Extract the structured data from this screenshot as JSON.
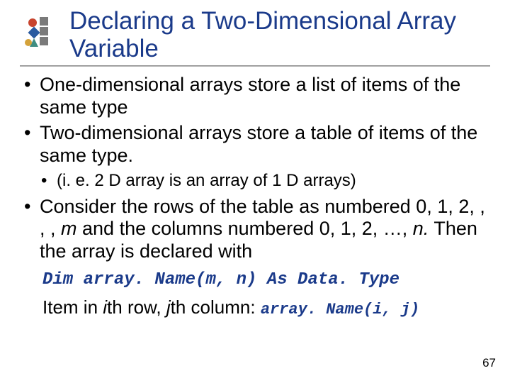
{
  "title": "Declaring a Two-Dimensional Array Variable",
  "bullets": {
    "b1": "One-dimensional arrays store a list of items of the same type",
    "b2": "Two-dimensional arrays store a table of items of the same type.",
    "b2a": "(i. e. 2 D array is an array of 1 D arrays)",
    "b3_pre": "Consider the rows of the table as numbered 0, 1, 2, , , , ",
    "b3_m": "m",
    "b3_mid": " and the columns numbered 0, 1, 2, …, ",
    "b3_n": "n.",
    "b3_post": " Then the array is declared with"
  },
  "code_decl": "Dim array. Name(m, n) As Data. Type",
  "item_line": {
    "pre": "Item in ",
    "i": "i",
    "mid1": "th row, ",
    "j": "j",
    "mid2": "th column: ",
    "code": "array. Name(i, j)"
  },
  "page_number": "67",
  "logo_colors": {
    "blue": "#2a5aa0",
    "red": "#c8442e",
    "gold": "#d4a23a",
    "teal": "#3f8d82",
    "gray": "#7a7a7a"
  }
}
